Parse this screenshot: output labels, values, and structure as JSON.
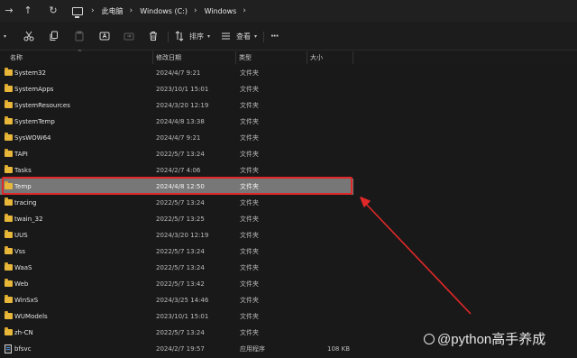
{
  "address_bar": {
    "breadcrumbs": [
      "此电脑",
      "Windows (C:)",
      "Windows"
    ],
    "icons": {
      "back": "arrow-left-icon",
      "forward": "arrow-right-icon",
      "up": "arrow-up-icon",
      "refresh": "refresh-icon",
      "pc": "monitor-icon"
    }
  },
  "toolbar": {
    "sort_label": "排序",
    "view_label": "查看",
    "more_label": "···"
  },
  "columns": {
    "name": "名称",
    "date": "修改日期",
    "type": "类型",
    "size": "大小"
  },
  "files": [
    {
      "name": "System32",
      "date": "2024/4/7 9:21",
      "type": "文件夹",
      "size": "",
      "kind": "folder"
    },
    {
      "name": "SystemApps",
      "date": "2023/10/1 15:01",
      "type": "文件夹",
      "size": "",
      "kind": "folder"
    },
    {
      "name": "SystemResources",
      "date": "2024/3/20 12:19",
      "type": "文件夹",
      "size": "",
      "kind": "folder"
    },
    {
      "name": "SystemTemp",
      "date": "2024/4/8 13:38",
      "type": "文件夹",
      "size": "",
      "kind": "folder"
    },
    {
      "name": "SysWOW64",
      "date": "2024/4/7 9:21",
      "type": "文件夹",
      "size": "",
      "kind": "folder"
    },
    {
      "name": "TAPI",
      "date": "2022/5/7 13:24",
      "type": "文件夹",
      "size": "",
      "kind": "folder"
    },
    {
      "name": "Tasks",
      "date": "2024/2/7 4:06",
      "type": "文件夹",
      "size": "",
      "kind": "folder"
    },
    {
      "name": "Temp",
      "date": "2024/4/8 12:50",
      "type": "文件夹",
      "size": "",
      "kind": "folder",
      "selected": true
    },
    {
      "name": "tracing",
      "date": "2022/5/7 13:24",
      "type": "文件夹",
      "size": "",
      "kind": "folder"
    },
    {
      "name": "twain_32",
      "date": "2022/5/7 13:25",
      "type": "文件夹",
      "size": "",
      "kind": "folder"
    },
    {
      "name": "UUS",
      "date": "2024/3/20 12:19",
      "type": "文件夹",
      "size": "",
      "kind": "folder"
    },
    {
      "name": "Vss",
      "date": "2022/5/7 13:24",
      "type": "文件夹",
      "size": "",
      "kind": "folder"
    },
    {
      "name": "WaaS",
      "date": "2022/5/7 13:24",
      "type": "文件夹",
      "size": "",
      "kind": "folder"
    },
    {
      "name": "Web",
      "date": "2022/5/7 13:42",
      "type": "文件夹",
      "size": "",
      "kind": "folder"
    },
    {
      "name": "WinSxS",
      "date": "2024/3/25 14:46",
      "type": "文件夹",
      "size": "",
      "kind": "folder"
    },
    {
      "name": "WUModels",
      "date": "2023/10/1 15:01",
      "type": "文件夹",
      "size": "",
      "kind": "folder"
    },
    {
      "name": "zh-CN",
      "date": "2022/5/7 13:24",
      "type": "文件夹",
      "size": "",
      "kind": "folder"
    },
    {
      "name": "bfsvc",
      "date": "2024/2/7 19:57",
      "type": "应用程序",
      "size": "108 KB",
      "kind": "app"
    }
  ],
  "watermark": "@python高手养成",
  "colors": {
    "folder": "#e8b73a",
    "selection": "#777777",
    "annotation": "#e02828"
  }
}
